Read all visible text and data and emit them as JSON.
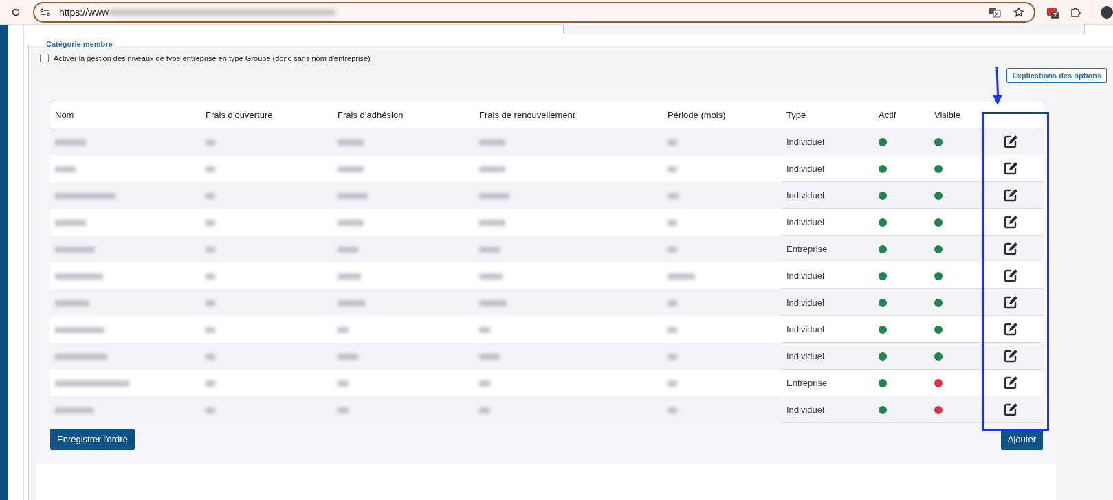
{
  "browser": {
    "url_prefix": "https://www",
    "extension_badge": "7"
  },
  "fieldset": {
    "legend": "Catégorie membre",
    "option": {
      "label": "Activer la gestion des niveaux de type entreprise en type Groupe (donc sans nom d'entreprise)",
      "checked": false
    }
  },
  "help_button": "Explications des options",
  "table": {
    "columns": [
      "Nom",
      "Frais d’ouverture",
      "Frais d’adhésion",
      "Frais de renouvellement",
      "Période (mois)",
      "Type",
      "Actif",
      "Visible"
    ],
    "rows": [
      {
        "type": "Individuel",
        "actif": {
          "color": "#1e8750"
        },
        "visible": {
          "color": "#1e8750"
        }
      },
      {
        "type": "Individuel",
        "actif": {
          "color": "#1e8750"
        },
        "visible": {
          "color": "#1e8750"
        }
      },
      {
        "type": "Individuel",
        "actif": {
          "color": "#1e8750"
        },
        "visible": {
          "color": "#1e8750"
        }
      },
      {
        "type": "Individuel",
        "actif": {
          "color": "#1e8750"
        },
        "visible": {
          "color": "#1e8750"
        }
      },
      {
        "type": "Entreprise",
        "actif": {
          "color": "#1e8750"
        },
        "visible": {
          "color": "#1e8750"
        }
      },
      {
        "type": "Individuel",
        "actif": {
          "color": "#1e8750"
        },
        "visible": {
          "color": "#1e8750"
        }
      },
      {
        "type": "Individuel",
        "actif": {
          "color": "#1e8750"
        },
        "visible": {
          "color": "#1e8750"
        }
      },
      {
        "type": "Individuel",
        "actif": {
          "color": "#1e8750"
        },
        "visible": {
          "color": "#1e8750"
        }
      },
      {
        "type": "Individuel",
        "actif": {
          "color": "#1e8750"
        },
        "visible": {
          "color": "#1e8750"
        }
      },
      {
        "type": "Entreprise",
        "actif": {
          "color": "#1e8750"
        },
        "visible": {
          "color": "#dc3545"
        }
      },
      {
        "type": "Individuel",
        "actif": {
          "color": "#1e8750"
        },
        "visible": {
          "color": "#dc3545"
        }
      }
    ]
  },
  "buttons": {
    "save_order": "Enregistrer l'ordre",
    "add": "Ajouter"
  }
}
